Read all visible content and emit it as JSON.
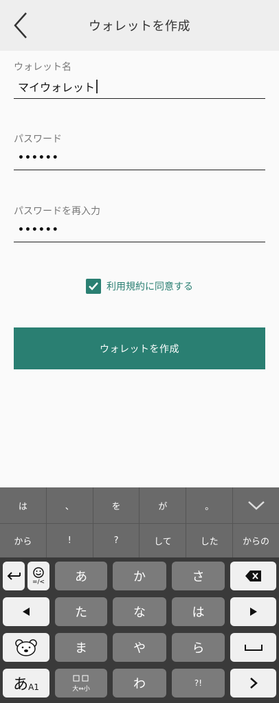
{
  "header": {
    "title": "ウォレットを作成"
  },
  "form": {
    "wallet_name": {
      "label": "ウォレット名",
      "value": "マイウォレット"
    },
    "password": {
      "label": "パスワード",
      "value": "••••••"
    },
    "password_confirm": {
      "label": "パスワードを再入力",
      "value": "••••••"
    },
    "terms": {
      "label": "利用規約に同意する",
      "checked": true
    },
    "submit_label": "ウォレットを作成"
  },
  "keyboard": {
    "suggestions_row1": [
      "は",
      "、",
      "を",
      "が",
      "。"
    ],
    "suggestions_row2": [
      "から",
      "!",
      "?",
      "して",
      "した",
      "からの"
    ],
    "keys": {
      "a": "あ",
      "ka": "か",
      "sa": "さ",
      "ta": "た",
      "na": "な",
      "ha": "は",
      "ma": "ま",
      "ya": "や",
      "ra": "ら",
      "wa": "わ",
      "mode": "あ",
      "mode_sub": "A1",
      "size_small": "大⇔小",
      "emoticon": "=/<",
      "punct_marks": "?!"
    }
  },
  "colors": {
    "accent": "#2a7f72",
    "header_bg": "#eeeeee",
    "keyboard_bg": "#3a3a3a"
  }
}
